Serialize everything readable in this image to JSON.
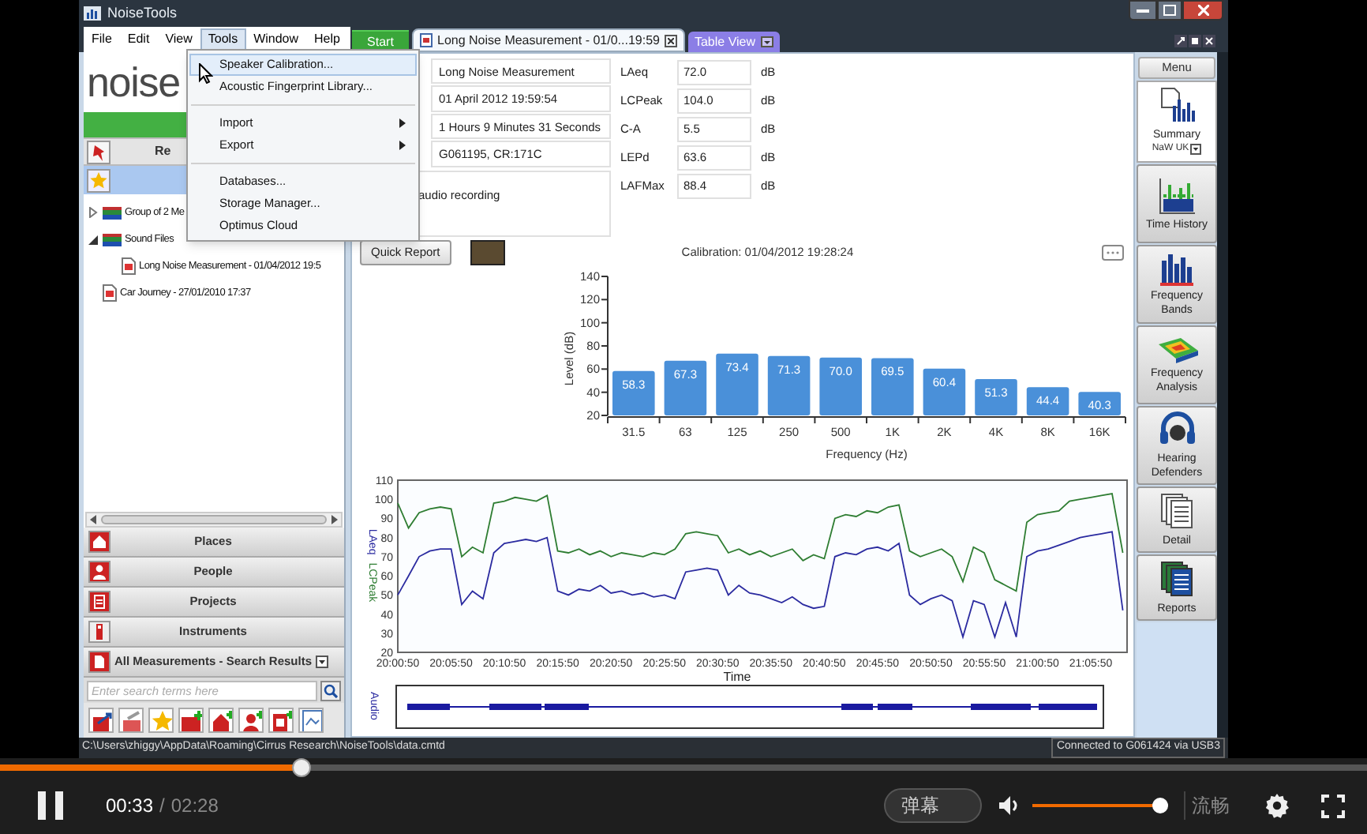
{
  "window": {
    "title": "NoiseTools"
  },
  "menu_bar": [
    {
      "label": "File",
      "selected": false
    },
    {
      "label": "Edit",
      "selected": false
    },
    {
      "label": "View",
      "selected": false
    },
    {
      "label": "Tools",
      "selected": true
    },
    {
      "label": "Window",
      "selected": false
    },
    {
      "label": "Help",
      "selected": false
    }
  ],
  "tools_menu": [
    [
      {
        "label": "Speaker Calibration...",
        "submenu": false,
        "selected": true
      },
      {
        "label": "Acoustic Fingerprint Library...",
        "submenu": false,
        "selected": false
      }
    ],
    [
      {
        "label": "Import",
        "submenu": true,
        "selected": false
      },
      {
        "label": "Export",
        "submenu": true,
        "selected": false
      }
    ],
    [
      {
        "label": "Databases...",
        "submenu": false,
        "selected": false
      },
      {
        "label": "Storage Manager...",
        "submenu": false,
        "selected": false
      },
      {
        "label": "Optimus Cloud",
        "submenu": false,
        "selected": false
      }
    ]
  ],
  "tabs": [
    {
      "kind": "start",
      "label": "Start",
      "selected": false
    },
    {
      "kind": "document",
      "label": "Long Noise Measurement - 01/0...19:59",
      "selected": true
    },
    {
      "kind": "dropdown",
      "label": "Table View",
      "selected": false
    }
  ],
  "sidebar": {
    "logo": "noise",
    "recent_label": "Re",
    "tree": [
      {
        "kind": "folder",
        "label": "Group of 2 Me",
        "expanded": false
      },
      {
        "kind": "folder",
        "label": "Sound Files",
        "expanded": true,
        "children": [
          {
            "kind": "file",
            "label": "Long Noise Measurement - 01/04/2012 19:5"
          }
        ]
      },
      {
        "kind": "file",
        "label": "Car Journey - 27/01/2010 17:37"
      }
    ],
    "sections": [
      {
        "label": "Places",
        "dropdown": false
      },
      {
        "label": "People",
        "dropdown": false
      },
      {
        "label": "Projects",
        "dropdown": false
      },
      {
        "label": "Instruments",
        "dropdown": false
      },
      {
        "label": "All Measurements - Search Results",
        "dropdown": true
      }
    ],
    "search": {
      "placeholder": "Enter search terms here"
    }
  },
  "summary": {
    "fields": [
      "Long Noise Measurement",
      "01 April 2012 19:59:54",
      "1 Hours 9 Minutes 31 Seconds",
      "G061195, CR:171C"
    ],
    "notes": "audio recording",
    "metrics": [
      {
        "name": "LAeq",
        "value": "72.0",
        "unit": "dB"
      },
      {
        "name": "LCPeak",
        "value": "104.0",
        "unit": "dB"
      },
      {
        "name": "C-A",
        "value": "5.5",
        "unit": "dB"
      },
      {
        "name": "LEPd",
        "value": "63.6",
        "unit": "dB"
      },
      {
        "name": "LAFMax",
        "value": "88.4",
        "unit": "dB"
      }
    ],
    "quick_report": "Quick Report",
    "calibration": "Calibration: 01/04/2012 19:28:24"
  },
  "frequency_chart": {
    "chart_data": {
      "type": "bar",
      "xlabel": "Frequency (Hz)",
      "ylabel": "Level (dB)",
      "categories": [
        "31.5",
        "63",
        "125",
        "250",
        "500",
        "1K",
        "2K",
        "4K",
        "8K",
        "16K"
      ],
      "values": [
        58.3,
        67.3,
        73.4,
        71.3,
        70.0,
        69.5,
        60.4,
        51.3,
        44.4,
        40.3
      ],
      "value_labels": [
        "58.3",
        "67.3",
        "73.4",
        "71.3",
        "70.0",
        "69.5",
        "60.4",
        "51.3",
        "44.4",
        "40.3"
      ],
      "ylim": [
        20,
        140
      ],
      "yticks": [
        20,
        40,
        60,
        80,
        100,
        120,
        140
      ]
    }
  },
  "time_history": {
    "chart_data": {
      "type": "line",
      "xlabel": "Time",
      "categories": [
        "20:00:50",
        null,
        null,
        null,
        null,
        "20:05:50",
        null,
        null,
        null,
        null,
        "20:10:50",
        null,
        null,
        null,
        null,
        "20:15:50",
        null,
        null,
        null,
        null,
        "20:20:50",
        null,
        null,
        null,
        null,
        "20:25:50",
        null,
        null,
        null,
        null,
        "20:30:50",
        null,
        null,
        null,
        null,
        "20:35:50",
        null,
        null,
        null,
        null,
        "20:40:50",
        null,
        null,
        null,
        null,
        "20:45:50",
        null,
        null,
        null,
        null,
        "20:50:50",
        null,
        null,
        null,
        null,
        "20:55:50",
        null,
        null,
        null,
        null,
        "21:00:50",
        null,
        null,
        null,
        null,
        "21:05:50",
        null,
        null,
        null
      ],
      "series": [
        {
          "name": "LAeq",
          "color": "#2b2ba0",
          "values": [
            50,
            60,
            70,
            73,
            74,
            74,
            45,
            52,
            48,
            72,
            77,
            78,
            79,
            78,
            80,
            52,
            50,
            53,
            52,
            55,
            51,
            52,
            50,
            51,
            49,
            50,
            48,
            62,
            63,
            64,
            63,
            50,
            55,
            51,
            50,
            48,
            46,
            49,
            45,
            43,
            44,
            70,
            72,
            71,
            74,
            75,
            73,
            77,
            50,
            45,
            48,
            50,
            47,
            28,
            47,
            45,
            28,
            46,
            28,
            70,
            73,
            74,
            76,
            78,
            80,
            81,
            82,
            83,
            42
          ]
        },
        {
          "name": "LCPeak",
          "color": "#2e7d32",
          "values": [
            98,
            85,
            93,
            95,
            96,
            95,
            70,
            75,
            72,
            98,
            99,
            101,
            100,
            99,
            102,
            73,
            72,
            74,
            71,
            73,
            70,
            72,
            71,
            70,
            72,
            71,
            74,
            82,
            83,
            82,
            81,
            72,
            74,
            71,
            73,
            70,
            72,
            74,
            68,
            71,
            69,
            90,
            92,
            91,
            94,
            93,
            96,
            97,
            73,
            70,
            72,
            74,
            70,
            57,
            75,
            72,
            58,
            55,
            52,
            88,
            92,
            93,
            94,
            99,
            100,
            101,
            102,
            103,
            72
          ]
        }
      ],
      "ylim": [
        20,
        110
      ],
      "yticks": [
        20,
        30,
        40,
        50,
        60,
        70,
        80,
        90,
        100,
        110
      ]
    },
    "audio_label": "Audio"
  },
  "right_panel": {
    "menu_button": "Menu",
    "views": [
      {
        "label": "Summary",
        "sublabel": "NaW UK",
        "selected": true
      },
      {
        "label": "Time History",
        "selected": false
      },
      {
        "label": "Frequency Bands",
        "selected": false
      },
      {
        "label": "Frequency Analysis",
        "selected": false
      },
      {
        "label": "Hearing Defenders",
        "selected": false
      },
      {
        "label": "Detail",
        "selected": false
      },
      {
        "label": "Reports",
        "selected": false
      }
    ]
  },
  "status_bar": {
    "path": "C:\\Users\\zhiggy\\AppData\\Roaming\\Cirrus Research\\NoiseTools\\data.cmtd",
    "connection": "Connected to G061424 via USB3"
  },
  "player": {
    "progress": {
      "level": 0.22
    },
    "time": "00:33",
    "separator": "/",
    "duration": "02:28",
    "danmaku": "弹幕",
    "danmaku_on": false,
    "volume": {
      "level": 0.94
    },
    "quality": "流畅"
  }
}
